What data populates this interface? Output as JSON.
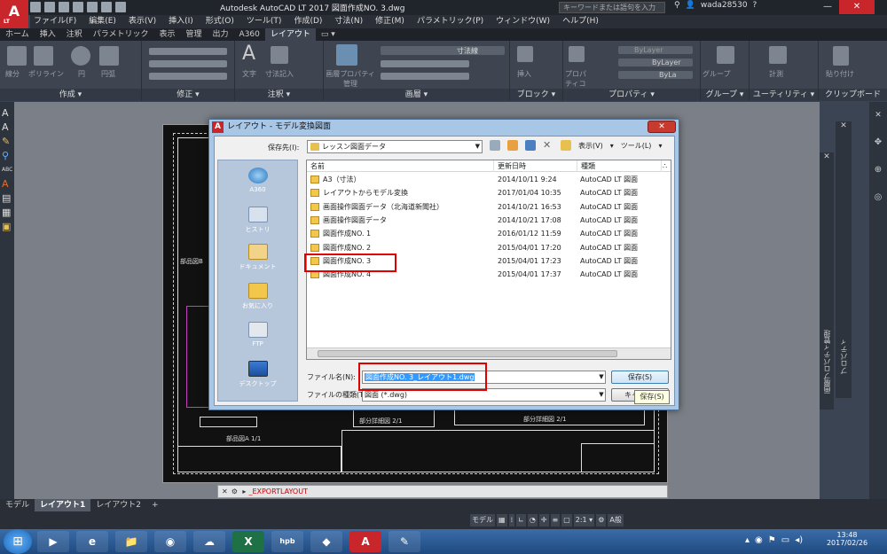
{
  "titlebar": {
    "app_title": "Autodesk AutoCAD LT 2017    図面作成NO. 3.dwg",
    "search_placeholder": "キーワードまたは語句を入力",
    "user": "wada28530",
    "logo": "A",
    "logo_sub": "LT"
  },
  "menu": [
    "ファイル(F)",
    "編集(E)",
    "表示(V)",
    "挿入(I)",
    "形式(O)",
    "ツール(T)",
    "作成(D)",
    "寸法(N)",
    "修正(M)",
    "パラメトリック(P)",
    "ウィンドウ(W)",
    "ヘルプ(H)"
  ],
  "ribbon_tabs": [
    "ホーム",
    "挿入",
    "注釈",
    "パラメトリック",
    "表示",
    "管理",
    "出力",
    "A360",
    "レイアウト"
  ],
  "ribbon_active_tab": "レイアウト",
  "ribbon_panels": [
    "作成 ▾",
    "修正 ▾",
    "注釈 ▾",
    "画層 ▾",
    "ブロック ▾",
    "プロパティ ▾",
    "グループ ▾",
    "ユーティリティ ▾",
    "クリップボード"
  ],
  "ribbon_labels": {
    "line": "線分",
    "polyline": "ポリライン",
    "circle": "円",
    "arc": "円弧",
    "text": "文字",
    "dimension": "寸法記入",
    "layer_props": "画層プロパティ管理",
    "insert": "挿入",
    "properties": "プロパティコピー",
    "group": "グループ",
    "measure": "計測",
    "paste": "貼り付け",
    "dim_style": "寸法線",
    "bylayer1": "ByLayer",
    "bylayer2": "ByLayer",
    "bylayer3": "ByLa"
  },
  "drawing": {
    "label_parts": "部品図B",
    "label_partA": "部品図A  1/1",
    "label_detail1": "部分詳細図  2/1",
    "label_detail2": "部分詳細図  2/1"
  },
  "command_line": "_EXPORTLAYOUT",
  "layout_tabs": [
    "モデル",
    "レイアウト1",
    "レイアウト2",
    "+"
  ],
  "layout_active": "レイアウト1",
  "right_palette": {
    "p1": "画層プロパティ管理",
    "p2": "プロパティ"
  },
  "statusbar": {
    "model": "モデル",
    "scale": "2:1 ▾",
    "ime": "A般"
  },
  "taskbar": {
    "apps": [
      "e",
      "📁",
      "◉",
      "☁",
      "X",
      "hpb",
      "◆",
      "A",
      "✎"
    ],
    "time": "13:48",
    "date": "2017/02/26"
  },
  "dialog": {
    "title": "レイアウト - モデル変換図面",
    "save_in_label": "保存先(I):",
    "save_in_value": "レッスン図面データ",
    "view_menu": "表示(V)",
    "tools_menu": "ツール(L)",
    "places": [
      "A360",
      "ヒストリ",
      "ドキュメント",
      "お気に入り",
      "FTP",
      "デスクトップ"
    ],
    "columns": [
      "名前",
      "更新日時",
      "種類",
      "∴"
    ],
    "files": [
      {
        "name": "A3（寸法）",
        "date": "2014/10/11 9:24",
        "type": "AutoCAD LT 図面"
      },
      {
        "name": "レイアウトからモデル変換",
        "date": "2017/01/04 10:35",
        "type": "AutoCAD LT 図面"
      },
      {
        "name": "画面操作図面データ（北海道新聞社）",
        "date": "2014/10/21 16:53",
        "type": "AutoCAD LT 図面"
      },
      {
        "name": "画面操作図面データ",
        "date": "2014/10/21 17:08",
        "type": "AutoCAD LT 図面"
      },
      {
        "name": "図面作成NO. 1",
        "date": "2016/01/12 11:59",
        "type": "AutoCAD LT 図面"
      },
      {
        "name": "図面作成NO. 2",
        "date": "2015/04/01 17:20",
        "type": "AutoCAD LT 図面"
      },
      {
        "name": "図面作成NO. 3",
        "date": "2015/04/01 17:23",
        "type": "AutoCAD LT 図面"
      },
      {
        "name": "図面作成NO. 4",
        "date": "2015/04/01 17:37",
        "type": "AutoCAD LT 図面"
      }
    ],
    "filename_label": "ファイル名(N):",
    "filename_value": "図面作成NO. 3_レイアウト1.dwg",
    "filetype_label": "ファイルの種類(T):",
    "filetype_value": "図面 (*.dwg)",
    "save_button": "保存(S)",
    "cancel_button": "キャ",
    "tooltip": "保存(S)"
  },
  "colors": {
    "accent_red": "#e00000",
    "autocad_red": "#c8262b",
    "dialog_frame": "#a8c6e5"
  }
}
